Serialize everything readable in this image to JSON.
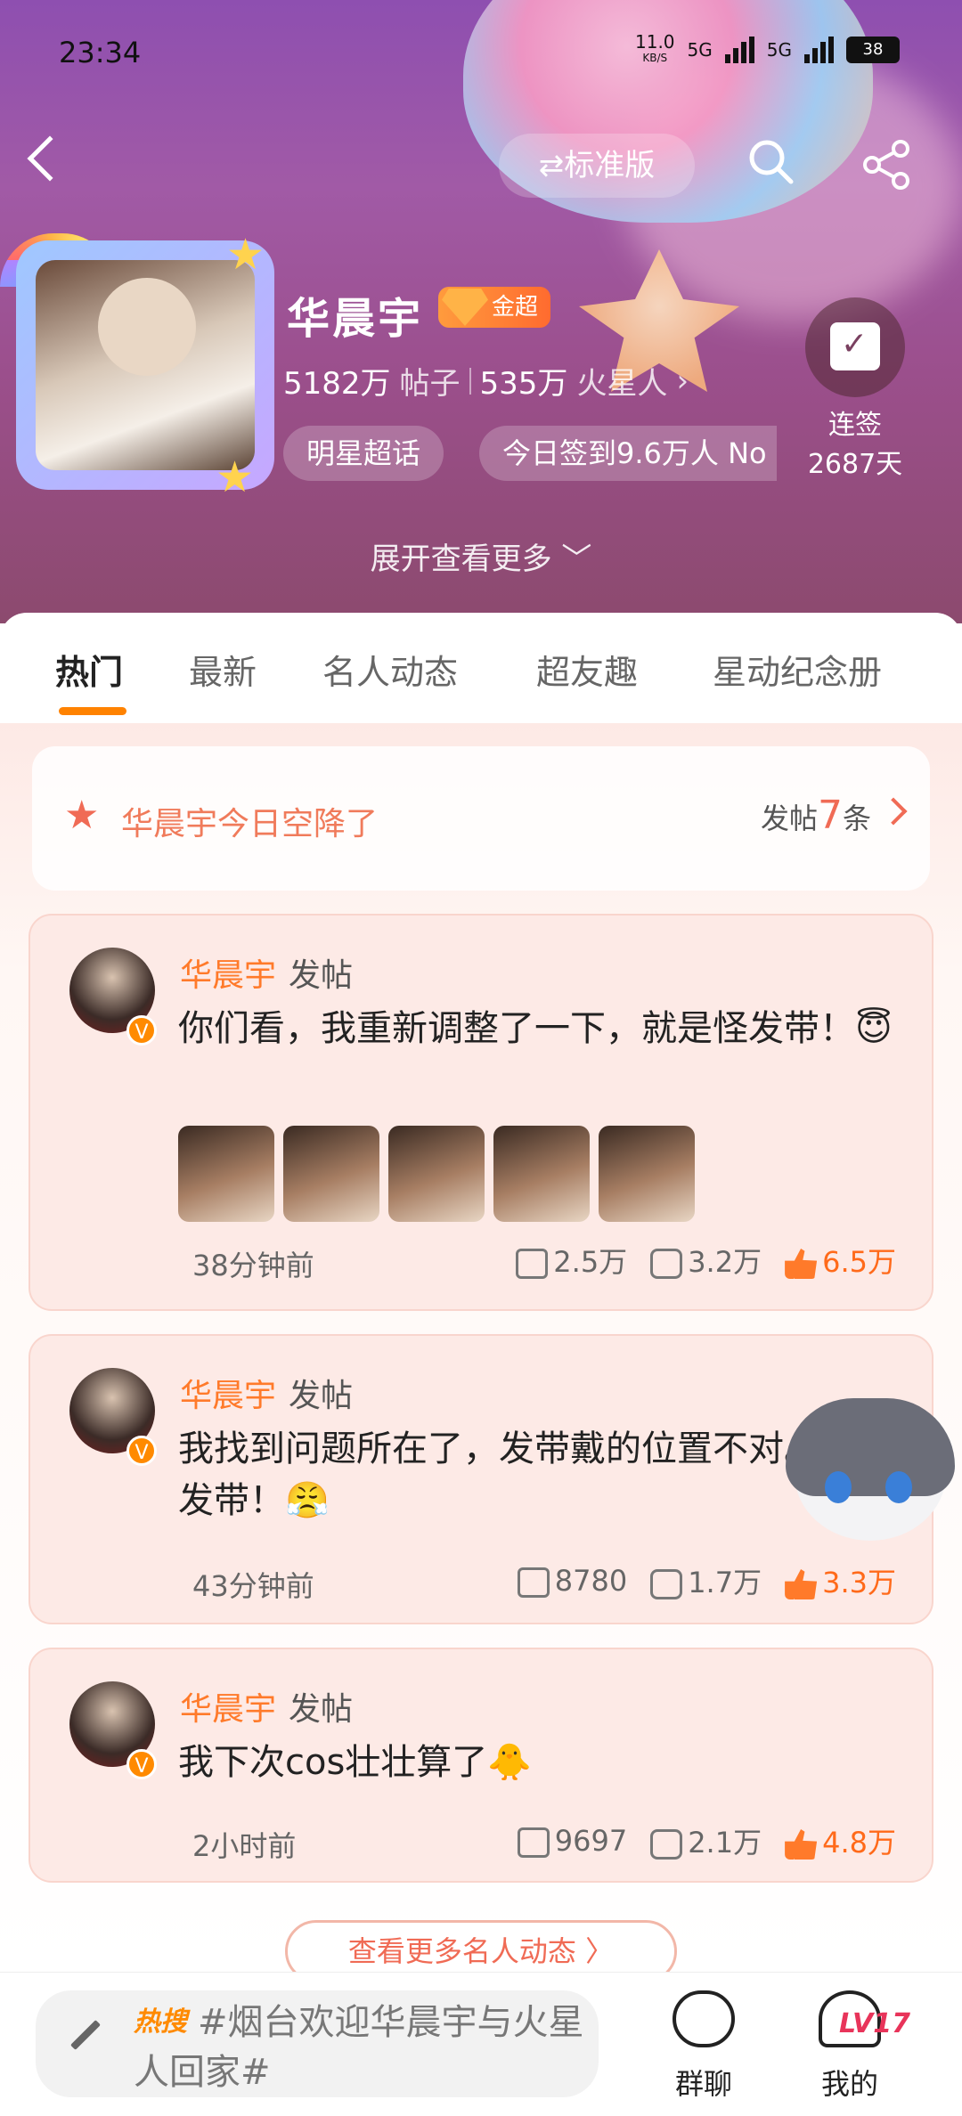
{
  "status_bar": {
    "time": "23:34",
    "net_speed": "11.0",
    "net_unit": "KB/S",
    "sim1": "5G",
    "sim2": "5G",
    "battery": "38"
  },
  "toolbar": {
    "mode_label": "⇄标准版"
  },
  "profile": {
    "name": "华晨宇",
    "badge_label": "金超",
    "posts_count": "5182万",
    "posts_unit": "帖子",
    "fans_count": "535万",
    "fans_unit": "火星人",
    "chip_star": "明星超话",
    "chip_checkin": "今日签到9.6万人 No",
    "checkin_label": "连签",
    "checkin_days": "2687天",
    "expand_label": "展开查看更多 ﹀"
  },
  "tabs": [
    {
      "label": "热门"
    },
    {
      "label": "最新"
    },
    {
      "label": "名人动态"
    },
    {
      "label": "超友趣"
    },
    {
      "label": "星动纪念册"
    }
  ],
  "airdrop": {
    "title": "华晨宇今日空降了",
    "count_prefix": "发帖",
    "count": "7",
    "count_suffix": "条"
  },
  "posts": [
    {
      "author": "华晨宇",
      "action": "发帖",
      "body": "你们看，我重新调整了一下，就是怪发带！😇",
      "time": "38分钟前",
      "shares": "2.5万",
      "comments": "3.2万",
      "likes": "6.5万"
    },
    {
      "author": "华晨宇",
      "action": "发帖",
      "body": "我找到问题所在了，发带戴的位置不对。怪发带！😤",
      "time": "43分钟前",
      "shares": "8780",
      "comments": "1.7万",
      "likes": "3.3万"
    },
    {
      "author": "华晨宇",
      "action": "发帖",
      "body": "我下次cos壮壮算了🐥",
      "time": "2小时前",
      "shares": "9697",
      "comments": "2.1万",
      "likes": "4.8万"
    }
  ],
  "more_button": "查看更多名人动态 〉",
  "bottom_bar": {
    "hot_label": "热搜",
    "topic": "#烟台欢迎华晨宇与火星人回家#",
    "group_chat": "群聊",
    "mine": "我的",
    "level": "LV17"
  }
}
